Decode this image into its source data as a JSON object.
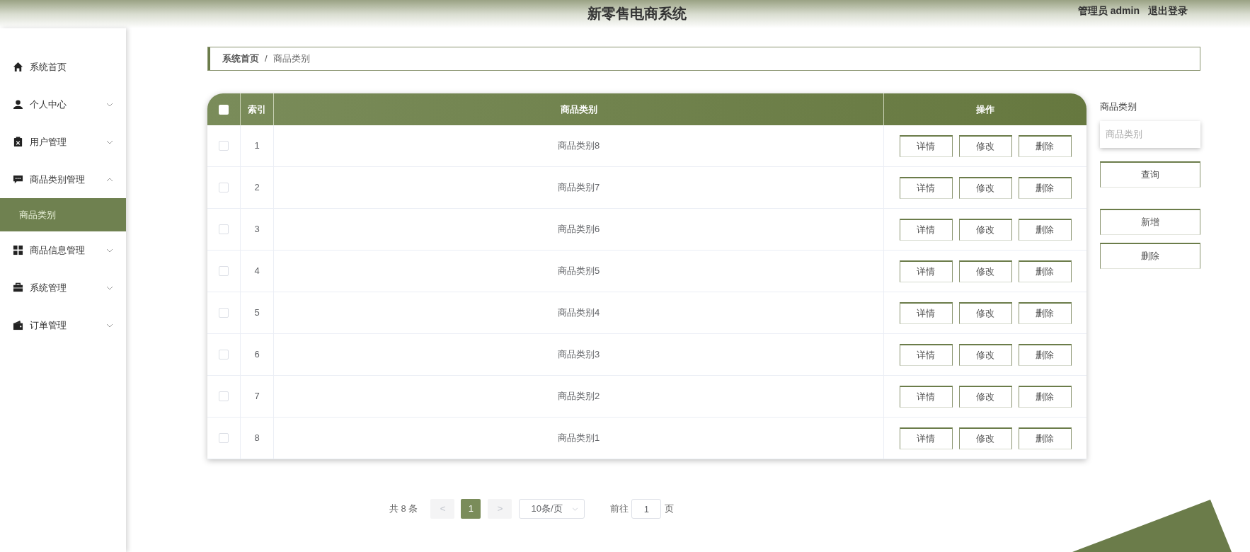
{
  "header": {
    "title": "新零售电商系统",
    "user": "管理员 admin",
    "logout": "退出登录"
  },
  "sidebar": {
    "items": [
      {
        "label": "系统首页"
      },
      {
        "label": "个人中心",
        "expanded": false
      },
      {
        "label": "用户管理",
        "expanded": false
      },
      {
        "label": "商品类别管理",
        "expanded": true,
        "children": [
          {
            "label": "商品类别",
            "selected": true
          }
        ]
      },
      {
        "label": "商品信息管理",
        "expanded": false
      },
      {
        "label": "系统管理",
        "expanded": false
      },
      {
        "label": "订单管理",
        "expanded": false
      }
    ]
  },
  "breadcrumb": [
    "系统首页",
    "/",
    "商品类别"
  ],
  "table": {
    "select_all_checked": false,
    "columns": [
      "索引",
      "商品类别",
      "操作"
    ],
    "rows": [
      {
        "checked": false,
        "index": "1",
        "category": "商品类别8",
        "actions": [
          "详情",
          "修改",
          "删除"
        ]
      },
      {
        "checked": false,
        "index": "2",
        "category": "商品类别7",
        "actions": [
          "详情",
          "修改",
          "删除"
        ]
      },
      {
        "checked": false,
        "index": "3",
        "category": "商品类别6",
        "actions": [
          "详情",
          "修改",
          "删除"
        ]
      },
      {
        "checked": false,
        "index": "4",
        "category": "商品类别5",
        "actions": [
          "详情",
          "修改",
          "删除"
        ]
      },
      {
        "checked": false,
        "index": "5",
        "category": "商品类别4",
        "actions": [
          "详情",
          "修改",
          "删除"
        ]
      },
      {
        "checked": false,
        "index": "6",
        "category": "商品类别3",
        "actions": [
          "详情",
          "修改",
          "删除"
        ]
      },
      {
        "checked": false,
        "index": "7",
        "category": "商品类别2",
        "actions": [
          "详情",
          "修改",
          "删除"
        ]
      },
      {
        "checked": false,
        "index": "8",
        "category": "商品类别1",
        "actions": [
          "详情",
          "修改",
          "删除"
        ]
      }
    ]
  },
  "search_panel": {
    "label": "商品类别",
    "placeholder": "商品类别",
    "buttons": [
      "查询",
      "新增",
      "删除"
    ]
  },
  "pagination": {
    "total": "共 8 条",
    "prev": "<",
    "pages": [
      {
        "label": "1",
        "selected": true
      }
    ],
    "next": ">",
    "page_size": "10条/页",
    "goto_label": "前往",
    "goto_value": "1",
    "page_suffix": "页"
  }
}
